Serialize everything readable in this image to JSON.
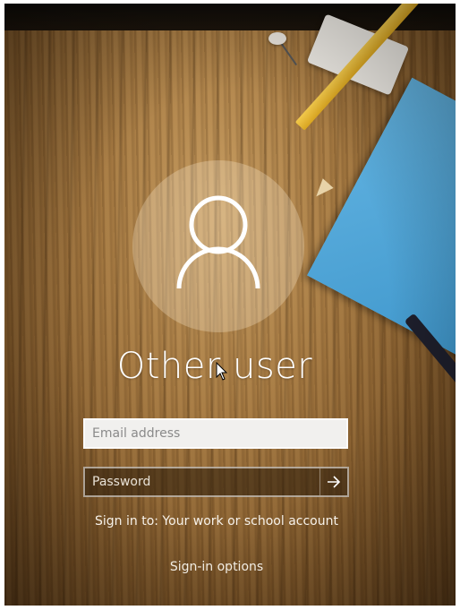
{
  "user": {
    "name": "Other user"
  },
  "fields": {
    "email_placeholder": "Email address",
    "email_value": "",
    "password_placeholder": "Password",
    "password_value": ""
  },
  "submit": {
    "icon": "arrow-right-icon"
  },
  "sign_in_to": "Sign in to: Your work or school account",
  "sign_in_options": "Sign-in options",
  "colors": {
    "avatar_fill": "#f5e6cc",
    "text": "#ffffff",
    "email_bg": "#f1f0ee",
    "password_bg": "#3a2812"
  }
}
